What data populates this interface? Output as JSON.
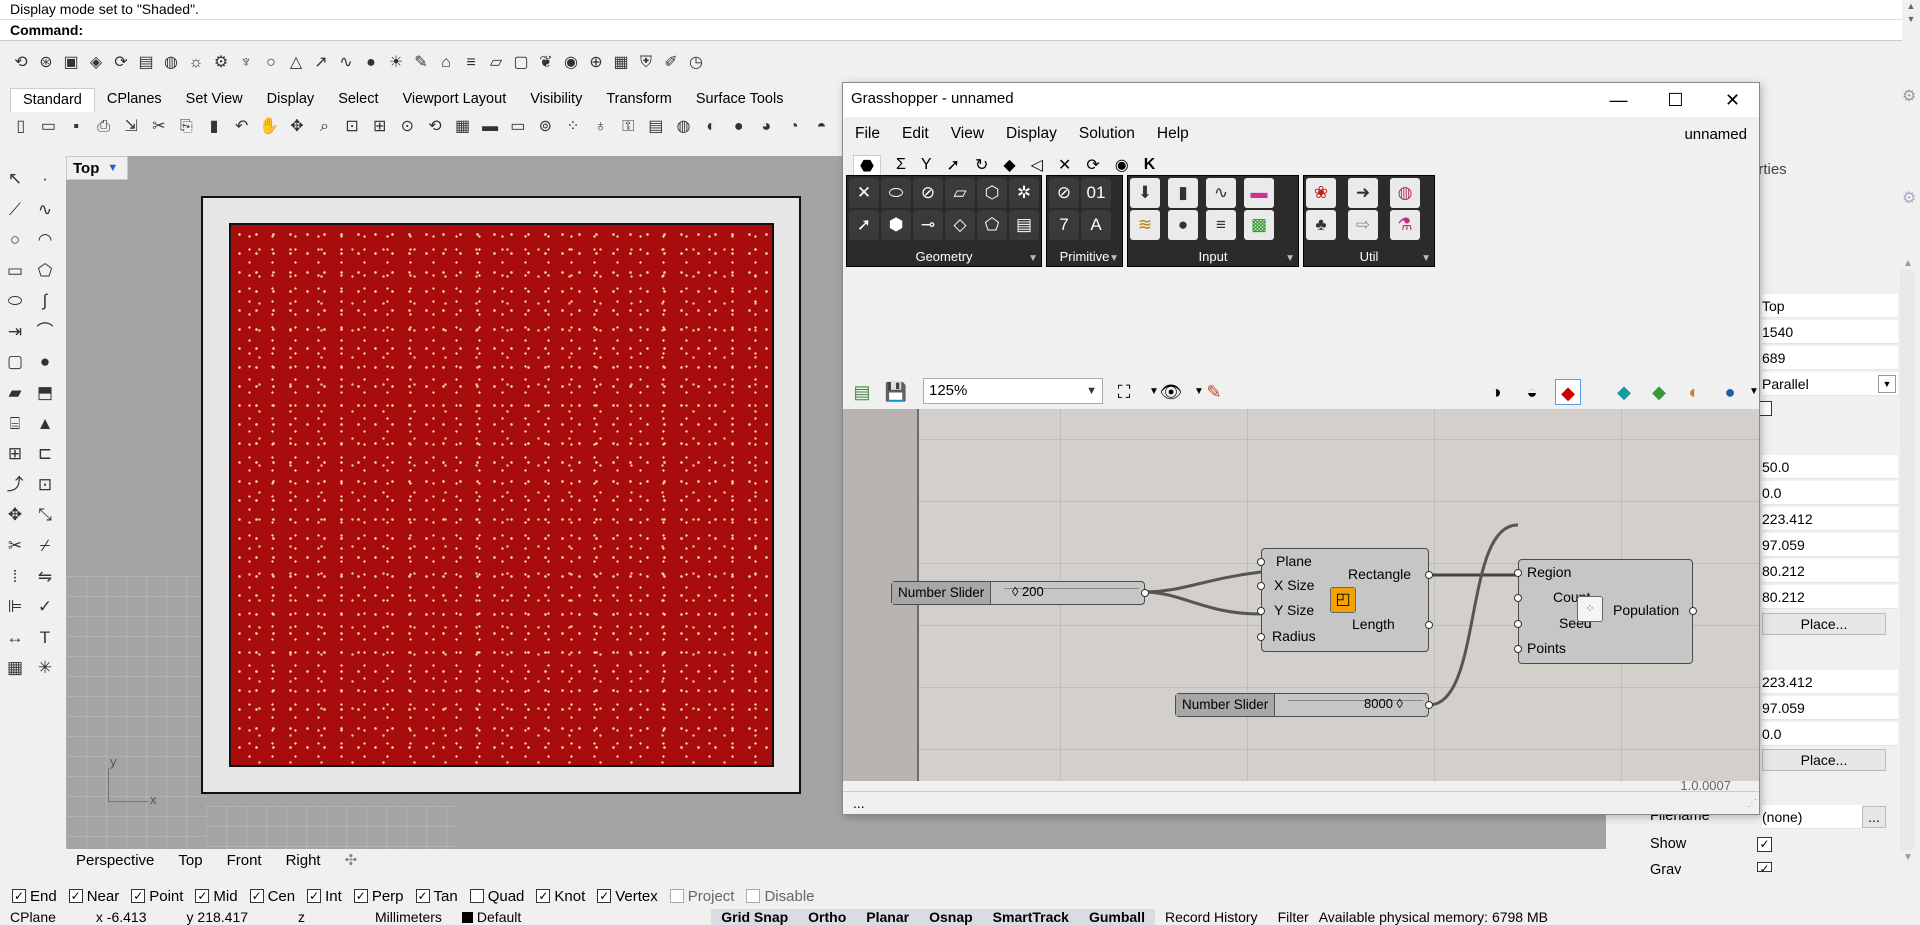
{
  "command": {
    "history": "Display mode set to \"Shaded\".",
    "prompt": "Command:"
  },
  "top_toolbar_icons": [
    "undo-redo-icon",
    "osnap-icon",
    "cube-icon",
    "shape-icon",
    "rotate-icon",
    "layer-icon",
    "materials-icon",
    "render-icon",
    "gear-icon",
    "lamp-icon",
    "circle-icon",
    "triangle-icon",
    "arrow-icon",
    "wire-icon",
    "sphere-icon",
    "sun-icon",
    "brush-icon",
    "analysis-icon",
    "lines-icon",
    "plane-icon",
    "box-icon",
    "grasshopper-icon",
    "palette-icon",
    "network-icon",
    "grid-icon",
    "shield-icon",
    "edit-icon",
    "clock-icon"
  ],
  "tabs": [
    "Standard",
    "CPlanes",
    "Set View",
    "Display",
    "Select",
    "Viewport Layout",
    "Visibility",
    "Transform",
    "Surface Tools"
  ],
  "std_toolbar_icons": [
    "new-icon",
    "open-icon",
    "save-icon",
    "print-icon",
    "import-icon",
    "cut-icon",
    "copy-icon",
    "paste-icon",
    "undo-icon",
    "pan-icon",
    "move-icon",
    "zoom-icon",
    "zoom-window-icon",
    "zoom-extents-icon",
    "zoom-selected-icon",
    "rotate-view-icon",
    "grid-icon",
    "car-icon",
    "car2-icon",
    "cplane-icon",
    "points-icon",
    "bulb-icon",
    "lock-icon",
    "layers-icon",
    "materials-icon",
    "colors-icon",
    "sphere-icon",
    "shaded-sphere-icon",
    "render-sphere-icon",
    "render2-icon",
    "pencil-icon"
  ],
  "left_tools": [
    "select-icon",
    "point-icon",
    "polyline-icon",
    "curve-icon",
    "circle-icon",
    "arc-icon",
    "rectangle-icon",
    "polygon-icon",
    "ellipse-icon",
    "curve2-icon",
    "extend-icon",
    "fillet-icon",
    "box-icon",
    "sphere-icon",
    "surface-icon",
    "extrude-icon",
    "cylinder-icon",
    "cone-icon",
    "mesh-icon",
    "pipe-icon",
    "bend-icon",
    "group-icon",
    "move-icon",
    "scale-icon",
    "trim-icon",
    "split-icon",
    "array-icon",
    "mirror-icon",
    "align-icon",
    "analyze-icon",
    "dimension-icon",
    "text-icon",
    "block-icon",
    "explode-icon"
  ],
  "viewport": {
    "name": "Top",
    "axis_x": "x",
    "axis_y": "y",
    "tabs": [
      "Perspective",
      "Top",
      "Front",
      "Right"
    ]
  },
  "osnaps": [
    {
      "label": "End",
      "checked": true,
      "disabled": false
    },
    {
      "label": "Near",
      "checked": true,
      "disabled": false
    },
    {
      "label": "Point",
      "checked": true,
      "disabled": false
    },
    {
      "label": "Mid",
      "checked": true,
      "disabled": false
    },
    {
      "label": "Cen",
      "checked": true,
      "disabled": false
    },
    {
      "label": "Int",
      "checked": true,
      "disabled": false
    },
    {
      "label": "Perp",
      "checked": true,
      "disabled": false
    },
    {
      "label": "Tan",
      "checked": true,
      "disabled": false
    },
    {
      "label": "Quad",
      "checked": false,
      "disabled": false
    },
    {
      "label": "Knot",
      "checked": true,
      "disabled": false
    },
    {
      "label": "Vertex",
      "checked": true,
      "disabled": false
    },
    {
      "label": "Project",
      "checked": false,
      "disabled": true
    },
    {
      "label": "Disable",
      "checked": false,
      "disabled": true
    }
  ],
  "status": {
    "cplane": "CPlane",
    "x": "x -6.413",
    "y": "y 218.417",
    "z": "z",
    "units": "Millimeters",
    "layer": "Default",
    "grid_snap": "Grid Snap",
    "ortho": "Ortho",
    "planar": "Planar",
    "osnap": "Osnap",
    "smarttrack": "SmartTrack",
    "gumball": "Gumball",
    "record_history": "Record History",
    "filter": "Filter",
    "memory": "Available physical memory: 6798 MB"
  },
  "properties": {
    "header": "erties",
    "values": [
      "Top",
      "1540",
      "689",
      "Parallel",
      "",
      "50.0",
      "0.0",
      "223.412",
      "97.059",
      "80.212",
      "80.212"
    ],
    "place1": "Place...",
    "values2": [
      "223.412",
      "97.059",
      "0.0"
    ],
    "place2": "Place...",
    "filename_label": "Filename",
    "filename_value": "(none)",
    "filename_btn": "...",
    "show_label": "Show",
    "gray_label": "Gray"
  },
  "grasshopper": {
    "title": "Grasshopper - unnamed",
    "doc_name": "unnamed",
    "menu": [
      "File",
      "Edit",
      "View",
      "Display",
      "Solution",
      "Help"
    ],
    "category_tabs": [
      "params-icon",
      "Σ",
      "Y",
      "curve-icon",
      "surface-icon",
      "mesh-icon",
      "intersect-icon",
      "transform-icon",
      "display-icon",
      "eye-icon",
      "K"
    ],
    "panels": [
      "Geometry",
      "Primitive",
      "Input",
      "Util"
    ],
    "zoom": "125%",
    "status_left": "...",
    "version": "1.0.0007",
    "components": {
      "slider1": {
        "name": "Number Slider",
        "value": "◊ 200"
      },
      "slider2": {
        "name": "Number Slider",
        "value": "8000 ◊"
      },
      "rectangle": {
        "inputs": [
          "Plane",
          "X Size",
          "Y Size",
          "Radius"
        ],
        "outputs": [
          "Rectangle",
          "Length"
        ]
      },
      "populate": {
        "inputs": [
          "Region",
          "Count",
          "Seed",
          "Points"
        ],
        "outputs": [
          "Population"
        ]
      }
    }
  },
  "colors": {
    "viewport_bg": "#a4a4a4",
    "rect_fill": "#a80c0c",
    "gh_canvas": "#d3d0cb"
  }
}
